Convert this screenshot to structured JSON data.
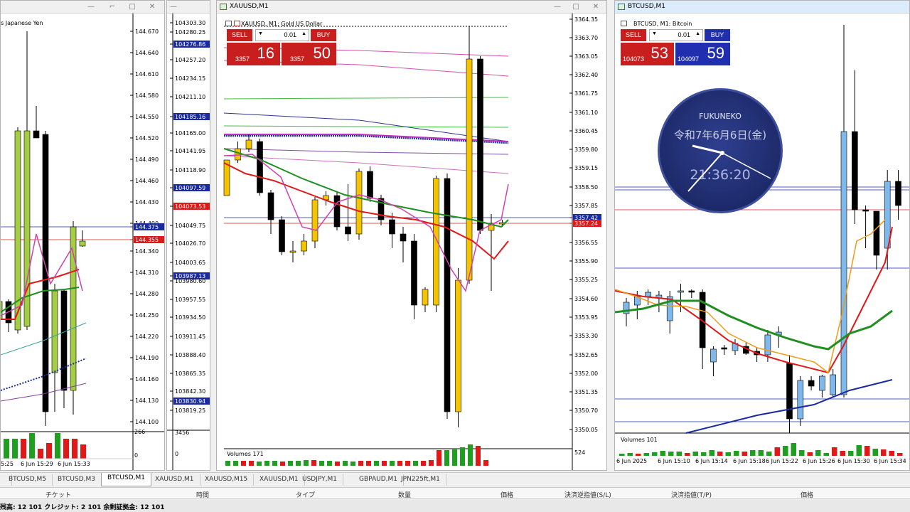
{
  "windows": {
    "left": {
      "title": "",
      "subtitle": "s Japanese Yen"
    },
    "middle_narrow": {
      "title": ""
    },
    "xau": {
      "title": "XAUUSD,M1",
      "subtitle": "XAUUSD, M1:  Gold US Dollar"
    },
    "btc": {
      "title": "BTCUSD,M1",
      "subtitle": "BTCUSD, M1:  Bitcoin"
    }
  },
  "left_axis": [
    "144.670",
    "144.640",
    "144.610",
    "144.580",
    "144.550",
    "144.520",
    "144.490",
    "144.460",
    "144.430",
    "144.400",
    "144.375",
    "144.355",
    "144.340",
    "144.310",
    "144.280",
    "144.250",
    "144.220",
    "144.190",
    "144.160",
    "144.130",
    "144.100"
  ],
  "left_times": [
    "5:25",
    "6 Jun 15:29",
    "6 Jun 15:33"
  ],
  "left_vol": [
    "266",
    "0"
  ],
  "mid_axis": [
    "104303.30",
    "104280.25",
    "104276.86",
    "104257.20",
    "104234.15",
    "104211.10",
    "104185.16",
    "104165.00",
    "104141.95",
    "104118.90",
    "104097.59",
    "104073.53",
    "104049.75",
    "104026.70",
    "104003.65",
    "103987.13",
    "103980.60",
    "103957.55",
    "103934.50",
    "103911.45",
    "103888.40",
    "103865.35",
    "103842.30",
    "103830.94",
    "103819.25"
  ],
  "mid_vol": [
    "3456",
    "0"
  ],
  "xau_axis": [
    "3364.35",
    "3363.70",
    "3363.05",
    "3362.40",
    "3361.75",
    "3361.10",
    "3360.45",
    "3359.80",
    "3359.15",
    "3358.50",
    "3357.85",
    "3357.42",
    "3357.24",
    "3356.55",
    "3355.90",
    "3355.25",
    "3354.60",
    "3353.95",
    "3353.30",
    "3352.65",
    "3352.00",
    "3351.35",
    "3350.70",
    "3350.05"
  ],
  "xau_vol": {
    "label": "Volumes 171",
    "axis": "524"
  },
  "xau_trade": {
    "sell": "SELL",
    "buy": "BUY",
    "lot": "0.01",
    "sell_small": "3357",
    "sell_big": "16",
    "buy_small": "3357",
    "buy_big": "50"
  },
  "btc_trade": {
    "sell": "SELL",
    "buy": "BUY",
    "lot": "0.01",
    "sell_small": "104073",
    "sell_big": "53",
    "buy_small": "104097",
    "buy_big": "59"
  },
  "btc_vol": {
    "label": "Volumes 101"
  },
  "btc_times": [
    "6 Jun 2025",
    "6 Jun 15:10",
    "6 Jun 15:14",
    "6 Jun 15:18",
    "6 Jun 15:22",
    "6 Jun 15:26",
    "6 Jun 15:30",
    "6 Jun 15:34"
  ],
  "clock": {
    "brand": "FUKUNEKO",
    "date": "令和7年6月6日(金)",
    "time": "21:36:20"
  },
  "tabs": [
    "",
    "BTCUSD,M5",
    "BTCUSD,M3",
    "BTCUSD,M1",
    "XAUUSD,M1",
    "XAUUSD,M15",
    "XAUUSD,M1",
    "USDJPY,M1",
    "GBPAUD,M1",
    "JPN225ft,M1"
  ],
  "terminal_headers": [
    "チケット",
    "時間",
    "タイプ",
    "数量",
    "価格",
    "決済逆指値(S/L)",
    "決済指値(T/P)",
    "価格"
  ],
  "status": "残高: 12 101  クレジット: 2 101  余剰証拠金: 12 101",
  "colors": {
    "bull_xau": "#f5c400",
    "bear": "#000000",
    "bull_usd": "#a4cc44",
    "bull_btc": "#7fb8ea",
    "ma_red": "#e01818",
    "ma_green": "#1f8f1f",
    "ma_orange": "#f09a1a",
    "ma_blue": "#1a2aa0"
  }
}
